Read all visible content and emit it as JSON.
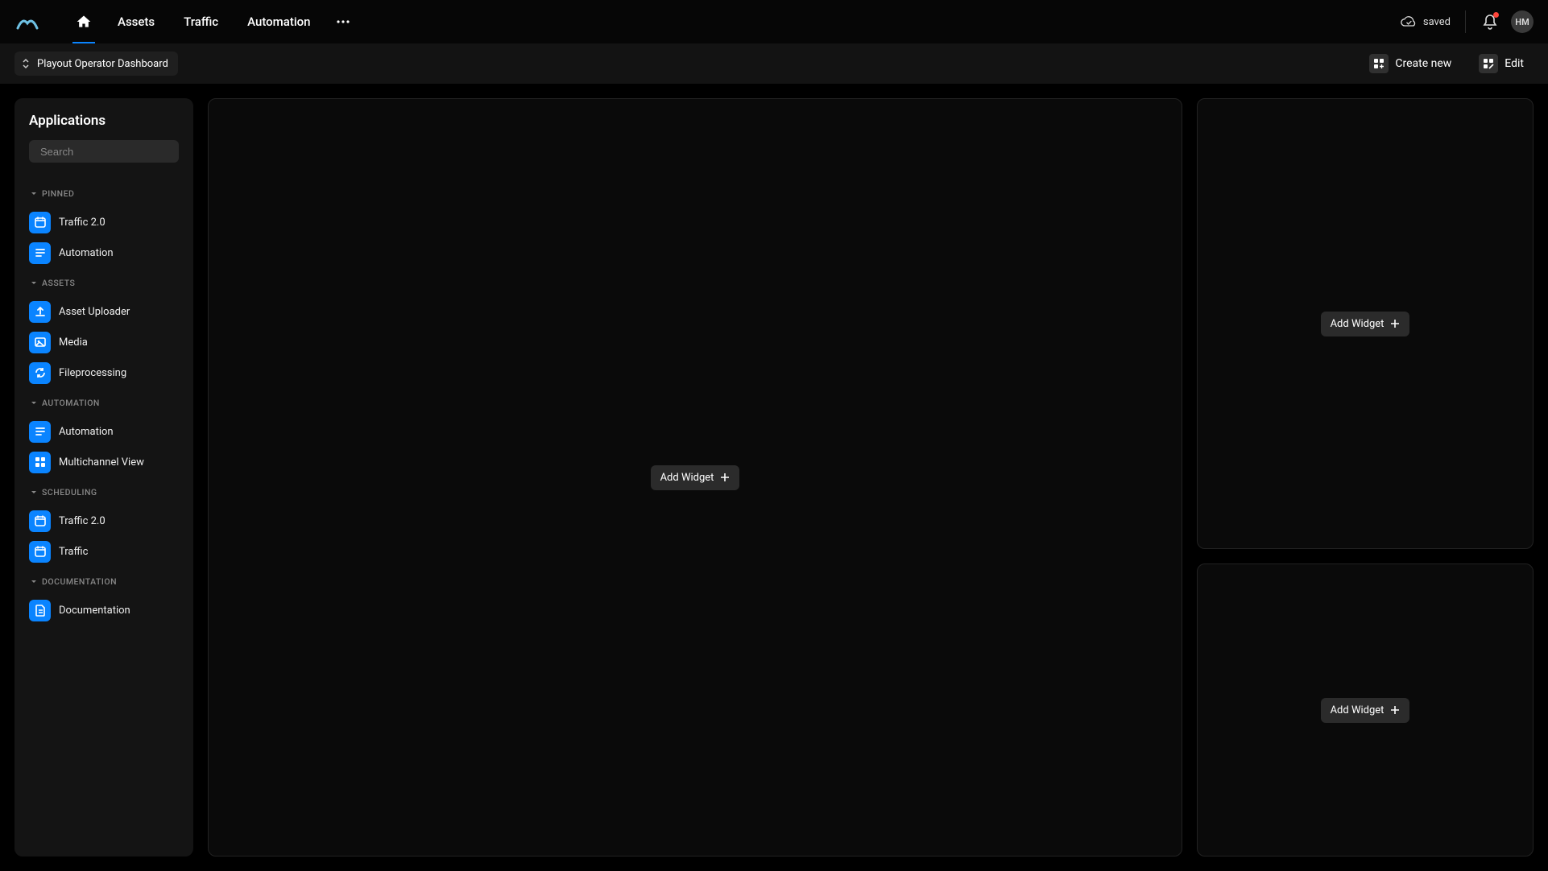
{
  "nav": {
    "items": [
      "Assets",
      "Traffic",
      "Automation"
    ]
  },
  "status": {
    "saved": "saved"
  },
  "user": {
    "initials": "HM"
  },
  "subbar": {
    "dashboard_name": "Playout Operator Dashboard",
    "create_new": "Create new",
    "edit": "Edit"
  },
  "sidebar": {
    "title": "Applications",
    "search_placeholder": "Search",
    "sections": [
      {
        "label": "PINNED",
        "items": [
          {
            "label": "Traffic 2.0",
            "icon": "calendar"
          },
          {
            "label": "Automation",
            "icon": "playlist"
          }
        ]
      },
      {
        "label": "ASSETS",
        "items": [
          {
            "label": "Asset Uploader",
            "icon": "upload"
          },
          {
            "label": "Media",
            "icon": "image"
          },
          {
            "label": "Fileprocessing",
            "icon": "sync"
          }
        ]
      },
      {
        "label": "AUTOMATION",
        "items": [
          {
            "label": "Automation",
            "icon": "playlist"
          },
          {
            "label": "Multichannel View",
            "icon": "grid"
          }
        ]
      },
      {
        "label": "SCHEDULING",
        "items": [
          {
            "label": "Traffic 2.0",
            "icon": "calendar"
          },
          {
            "label": "Traffic",
            "icon": "calendar"
          }
        ]
      },
      {
        "label": "DOCUMENTATION",
        "items": [
          {
            "label": "Documentation",
            "icon": "doc"
          }
        ]
      }
    ]
  },
  "widgets": {
    "add_label": "Add Widget"
  }
}
